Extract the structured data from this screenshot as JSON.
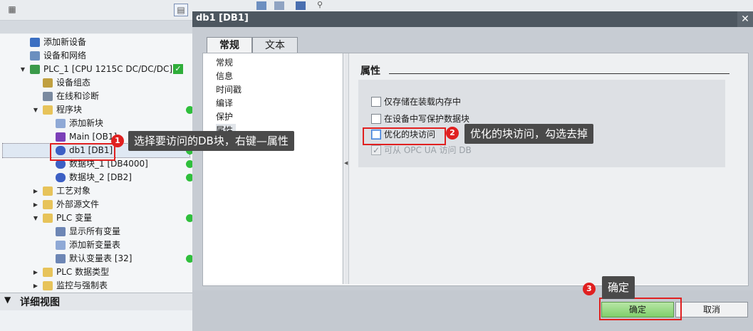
{
  "tree": {
    "items": [
      {
        "label": "添加新设备",
        "icon": "add-device-icon"
      },
      {
        "label": "设备和网络",
        "icon": "network-icon"
      },
      {
        "label": "PLC_1 [CPU 1215C DC/DC/DC]",
        "icon": "plc-icon"
      },
      {
        "label": "设备组态",
        "icon": "device-config-icon"
      },
      {
        "label": "在线和诊断",
        "icon": "online-diagnostics-icon"
      },
      {
        "label": "程序块",
        "icon": "folder-icon"
      },
      {
        "label": "添加新块",
        "icon": "add-block-icon"
      },
      {
        "label": "Main [OB1]",
        "icon": "ob-block-icon"
      },
      {
        "label": "db1 [DB1]",
        "icon": "db-block-icon"
      },
      {
        "label": "数据块_1 [DB4000]",
        "icon": "db-block-icon"
      },
      {
        "label": "数据块_2 [DB2]",
        "icon": "db-block-icon"
      },
      {
        "label": "工艺对象",
        "icon": "folder-icon"
      },
      {
        "label": "外部源文件",
        "icon": "folder-icon"
      },
      {
        "label": "PLC 变量",
        "icon": "folder-icon"
      },
      {
        "label": "显示所有变量",
        "icon": "tag-table-icon"
      },
      {
        "label": "添加新变量表",
        "icon": "add-tag-table-icon"
      },
      {
        "label": "默认变量表 [32]",
        "icon": "tag-table-icon"
      },
      {
        "label": "PLC 数据类型",
        "icon": "folder-icon"
      },
      {
        "label": "监控与强制表",
        "icon": "folder-icon"
      }
    ],
    "detail_view": "详细视图"
  },
  "dialog": {
    "title": "db1 [DB1]",
    "close": "✕",
    "tabs": [
      "常规",
      "文本"
    ],
    "nav": [
      "常规",
      "信息",
      "时间戳",
      "编译",
      "保护",
      "属性"
    ],
    "section_title": "属性",
    "options": [
      {
        "label": "仅存储在装载内存中",
        "checked": false,
        "enabled": true
      },
      {
        "label": "在设备中写保护数据块",
        "checked": false,
        "enabled": true
      },
      {
        "label": "优化的块访问",
        "checked": false,
        "enabled": true
      },
      {
        "label": "可从 OPC UA 访问 DB",
        "checked": true,
        "enabled": false
      }
    ],
    "ok": "确定",
    "cancel": "取消"
  },
  "annotations": [
    {
      "number": "1",
      "text": "选择要访问的DB块，右键—属性"
    },
    {
      "number": "2",
      "text": "优化的块访问，勾选去掉"
    },
    {
      "number": "3",
      "text": "确定"
    }
  ],
  "colors": {
    "annotation_red": "#e02020",
    "status_green": "#2fbf3c",
    "ok_green": "#7fcf6b",
    "titlebar": "#4d5760"
  }
}
